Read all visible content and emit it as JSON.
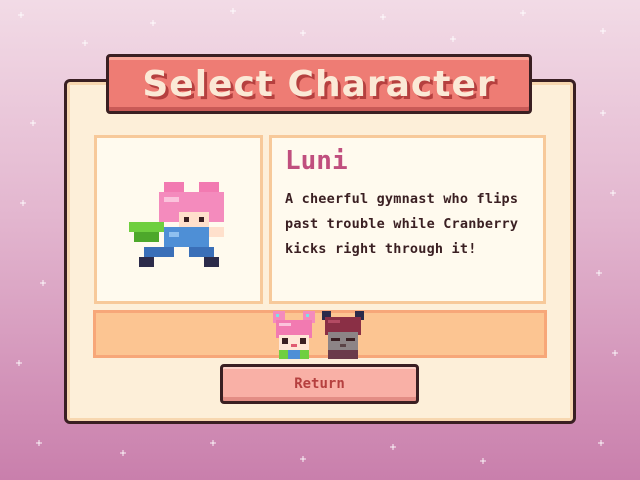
{
  "title": "Select Character",
  "selected_character": {
    "name": "Luni",
    "description": "A cheerful gymnast who flips past trouble while Cranberry kicks right through it!"
  },
  "roster": [
    {
      "icon": "luni-portrait-icon",
      "selected": true
    },
    {
      "icon": "cranberry-portrait-icon",
      "selected": false
    }
  ],
  "buttons": {
    "return_label": "Return"
  },
  "colors": {
    "banner": "#ee7c74",
    "panel": "#fdefd9",
    "name_text": "#c04f7e",
    "button": "#f9b0a6"
  }
}
